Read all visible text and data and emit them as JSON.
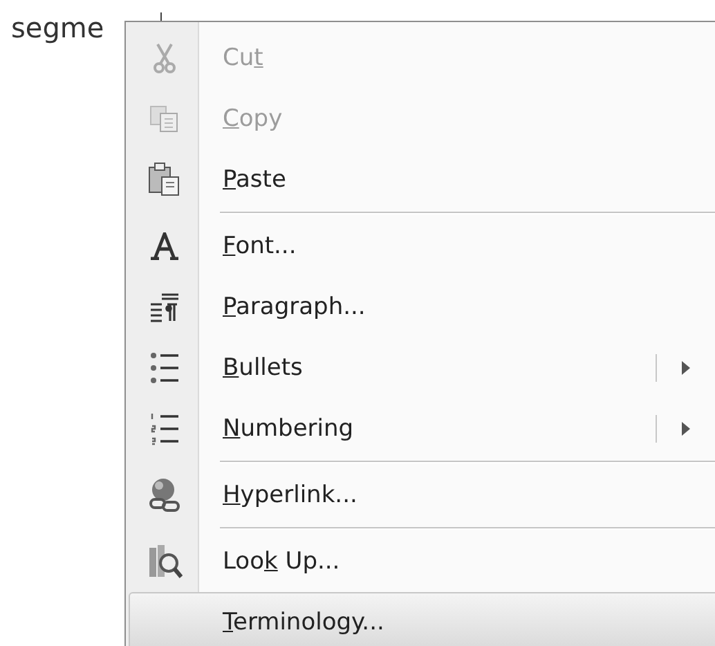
{
  "document": {
    "text": "segme"
  },
  "context_menu": {
    "items": [
      {
        "kind": "command",
        "before": "Cu",
        "key": "t",
        "disabled": true,
        "selected": false
      },
      {
        "kind": "command",
        "key": "C",
        "after": "opy",
        "disabled": true,
        "selected": false
      },
      {
        "kind": "command",
        "key": "P",
        "after": "aste",
        "disabled": false,
        "selected": false
      },
      {
        "kind": "separator"
      },
      {
        "kind": "command",
        "key": "F",
        "after": "ont...",
        "disabled": false,
        "selected": false
      },
      {
        "kind": "command",
        "key": "P",
        "after": "aragraph...",
        "disabled": false,
        "selected": false
      },
      {
        "kind": "submenu",
        "key": "B",
        "after": "ullets",
        "disabled": false,
        "selected": false
      },
      {
        "kind": "submenu",
        "key": "N",
        "after": "umbering",
        "disabled": false,
        "selected": false
      },
      {
        "kind": "separator"
      },
      {
        "kind": "command",
        "key": "H",
        "after": "yperlink...",
        "disabled": false,
        "selected": false
      },
      {
        "kind": "separator"
      },
      {
        "kind": "command",
        "before": "Loo",
        "key": "k",
        "after": " Up...",
        "disabled": false,
        "selected": false
      },
      {
        "kind": "command",
        "key": "T",
        "after": "erminology...",
        "disabled": false,
        "selected": true
      }
    ]
  }
}
